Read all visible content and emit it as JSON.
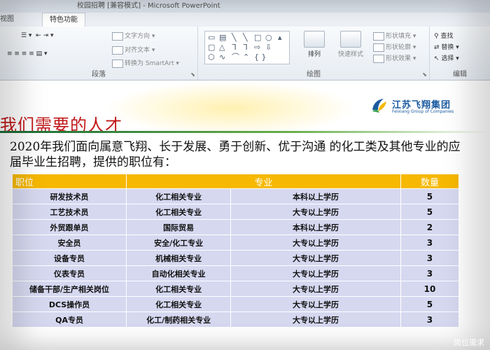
{
  "window": {
    "title": "校园招聘 [兼容模式] - Microsoft PowerPoint",
    "left_edge": "视图"
  },
  "ribbon": {
    "active_tab": "特色功能",
    "paragraph_group": {
      "label": "段落",
      "text_direction": "文字方向",
      "align_text": "对齐文本",
      "convert_smartart": "转换为 SmartArt"
    },
    "drawing_group": {
      "label": "绘图",
      "arrange": "排列",
      "quick_styles": "快速样式",
      "shape_fill": "形状填充",
      "shape_outline": "形状轮廓",
      "shape_effects": "形状效果"
    },
    "editing_group": {
      "label": "编辑",
      "find": "查找",
      "replace": "替换",
      "select": "选择"
    }
  },
  "slide": {
    "title": "我们需要的人才",
    "logo": {
      "name_cn": "江苏飞翔集团",
      "name_en": "Feixiang Group of Companies"
    },
    "intro": "2020年我们面向属意飞翔、长于发展、勇于创新、优于沟通 的化工类及其他专业的应届毕业生招聘，提供的职位有：",
    "table": {
      "headers": [
        "职位",
        "专业",
        "",
        "数量"
      ],
      "rows": [
        [
          "研发技术员",
          "化工相关专业",
          "本科以上学历",
          "5"
        ],
        [
          "工艺技术员",
          "化工相关专业",
          "大专以上学历",
          "5"
        ],
        [
          "外贸跟单员",
          "国际贸易",
          "本科以上学历",
          "2"
        ],
        [
          "安全员",
          "安全/化工专业",
          "大专以上学历",
          "3"
        ],
        [
          "设备专员",
          "机械相关专业",
          "大专以上学历",
          "3"
        ],
        [
          "仪表专员",
          "自动化相关专业",
          "大专以上学历",
          "3"
        ],
        [
          "储备干部/生产相关岗位",
          "化工相关专业",
          "大专以上学历",
          "10"
        ],
        [
          "DCS操作员",
          "化工相关专业",
          "大专以上学历",
          "5"
        ],
        [
          "QA专员",
          "化工/制药相关专业",
          "大专以上学历",
          "3"
        ]
      ]
    }
  },
  "caption": "岗位需求",
  "colors": {
    "header_yellow": "#f6b800",
    "row_lavender": "#d6d8f0",
    "title_red": "#c01818"
  }
}
